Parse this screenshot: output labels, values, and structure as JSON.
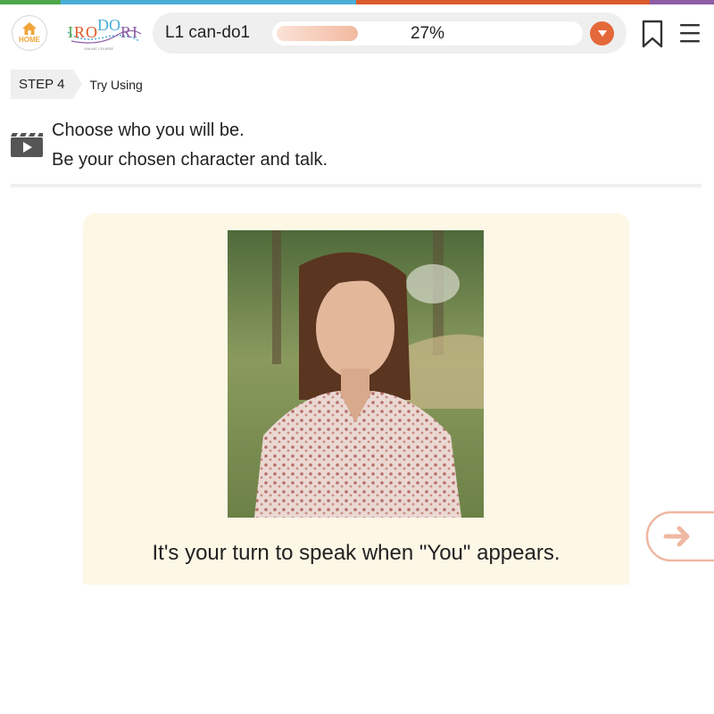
{
  "top_strip": {
    "colors": [
      "#4fa84b",
      "#4aaed9",
      "#dc5a2a",
      "#8c5ea6"
    ]
  },
  "header": {
    "home_label": "HOME",
    "logo_text": "IRODORI",
    "logo_subtitle": "ONLINE COURSE",
    "lesson_title": "L1 can-do1",
    "progress_percent": 27,
    "progress_text": "27%",
    "accent_color": "#e4693a",
    "icons": {
      "home": "home-icon",
      "dropdown": "chevron-down-icon",
      "bookmark": "bookmark-icon",
      "menu": "hamburger-menu-icon"
    }
  },
  "step": {
    "badge": "STEP 4",
    "name": "Try Using"
  },
  "instruction": {
    "icon": "video-icon",
    "line1": "Choose who you will be.",
    "line2": "Be your chosen character and talk."
  },
  "card": {
    "photo_alt": "Woman in floral blouse standing outdoors",
    "caption": "It's your turn to speak when \"You\" appears."
  },
  "navigation": {
    "next_icon": "arrow-right-icon"
  }
}
